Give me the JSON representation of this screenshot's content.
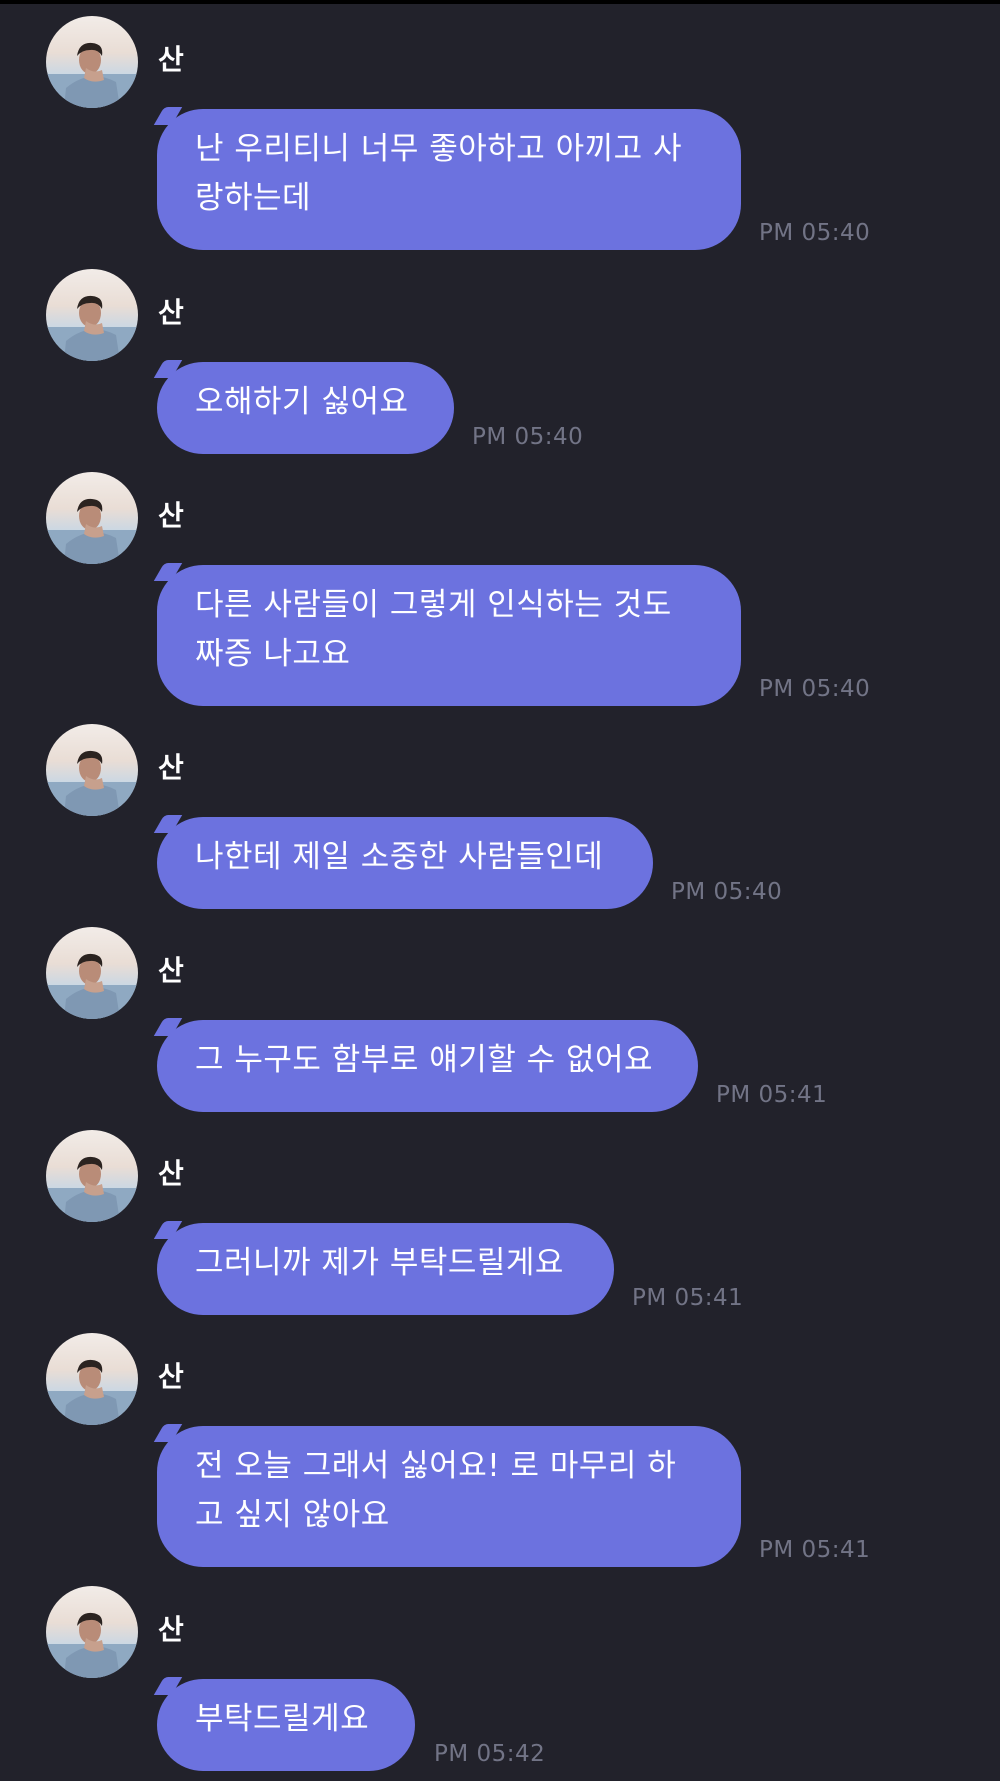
{
  "chat": {
    "messages": [
      {
        "sender": "산",
        "text": "난 우리티니 너무 좋아하고 아끼고 사\n랑하는데",
        "time": "PM 05:40"
      },
      {
        "sender": "산",
        "text": "오해하기 싫어요",
        "time": "PM 05:40"
      },
      {
        "sender": "산",
        "text": "다른 사람들이 그렇게 인식하는 것도\n짜증 나고요",
        "time": "PM 05:40"
      },
      {
        "sender": "산",
        "text": "나한테 제일 소중한 사람들인데",
        "time": "PM 05:40"
      },
      {
        "sender": "산",
        "text": "그 누구도 함부로 얘기할 수 없어요",
        "time": "PM 05:41"
      },
      {
        "sender": "산",
        "text": "그러니까 제가 부탁드릴게요",
        "time": "PM 05:41"
      },
      {
        "sender": "산",
        "text": "전 오늘 그래서 싫어요! 로 마무리 하\n고 싶지 않아요",
        "time": "PM 05:41"
      },
      {
        "sender": "산",
        "text": "부탁드릴게요",
        "time": "PM 05:42"
      }
    ]
  },
  "colors": {
    "background": "#22222b",
    "bubble": "#6c72df",
    "timestamp": "#727486"
  },
  "icons": {
    "avatar": "profile-photo"
  }
}
